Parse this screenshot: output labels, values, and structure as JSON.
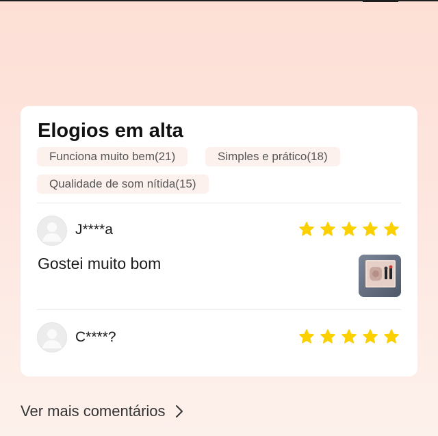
{
  "colors": {
    "star": "#fbd000",
    "page_gradient_top": "#fddfd5",
    "tag_background": "#fdf1ee"
  },
  "card": {
    "title": "Elogios em alta",
    "tags": [
      {
        "label": "Funciona muito bem(21)"
      },
      {
        "label": "Simples e prático(18)"
      },
      {
        "label": "Qualidade de som nítida(15)"
      }
    ]
  },
  "reviews": [
    {
      "username": "J****a",
      "rating": 5,
      "text": "Gostei muito bom",
      "has_photo": true,
      "avatar_icon": "default-user-icon"
    },
    {
      "username": "C****?",
      "rating": 5,
      "avatar_icon": "default-user-icon"
    }
  ],
  "footer": {
    "see_more_label": "Ver mais comentários",
    "see_more_icon": "chevron-right-icon"
  }
}
